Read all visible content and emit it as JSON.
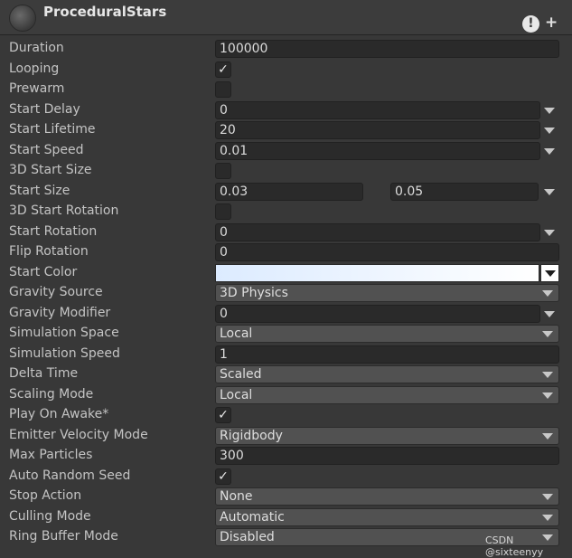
{
  "header": {
    "title": "ProceduralStars",
    "alert_glyph": "!",
    "add_glyph": "+"
  },
  "rows": [
    {
      "label": "Duration",
      "value": "100000"
    },
    {
      "label": "Looping",
      "checked": true
    },
    {
      "label": "Prewarm",
      "checked": false
    },
    {
      "label": "Start Delay",
      "value": "0"
    },
    {
      "label": "Start Lifetime",
      "value": "20"
    },
    {
      "label": "Start Speed",
      "value": "0.01"
    },
    {
      "label": "3D Start Size",
      "checked": false
    },
    {
      "label": "Start Size",
      "min": "0.03",
      "max": "0.05"
    },
    {
      "label": "3D Start Rotation",
      "checked": false
    },
    {
      "label": "Start Rotation",
      "value": "0"
    },
    {
      "label": "Flip Rotation",
      "value": "0"
    },
    {
      "label": "Start Color",
      "color_from": "#dcebff",
      "color_to": "#ffffff"
    },
    {
      "label": "Gravity Source",
      "option": "3D Physics"
    },
    {
      "label": "Gravity Modifier",
      "value": "0"
    },
    {
      "label": "Simulation Space",
      "option": "Local"
    },
    {
      "label": "Simulation Speed",
      "value": "1"
    },
    {
      "label": "Delta Time",
      "option": "Scaled"
    },
    {
      "label": "Scaling Mode",
      "option": "Local"
    },
    {
      "label": "Play On Awake*",
      "checked": true
    },
    {
      "label": "Emitter Velocity Mode",
      "option": "Rigidbody"
    },
    {
      "label": "Max Particles",
      "value": "300"
    },
    {
      "label": "Auto Random Seed",
      "checked": true
    },
    {
      "label": "Stop Action",
      "option": "None"
    },
    {
      "label": "Culling Mode",
      "option": "Automatic"
    },
    {
      "label": "Ring Buffer Mode",
      "option": "Disabled"
    }
  ],
  "check_glyph": "✓",
  "watermark": "CSDN @sixteenyy",
  "colors": {
    "background": "#383838",
    "field": "#2a2a2a",
    "dropdown": "#515151",
    "text": "#c4c4c4"
  }
}
